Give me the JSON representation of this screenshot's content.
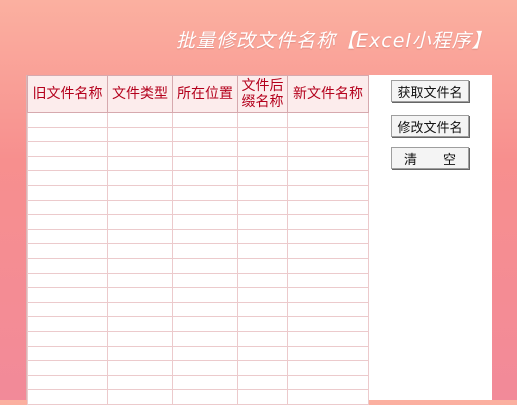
{
  "banner": {
    "title": "批量修改文件名称【Excel小程序】"
  },
  "table": {
    "headers": [
      "旧文件名称",
      "文件类型",
      "所在位置",
      "文件后缀名称",
      "新文件名称"
    ],
    "header_lines": [
      [
        "旧文件名称"
      ],
      [
        "文件类型"
      ],
      [
        "所在位置"
      ],
      [
        "文件后",
        "缀名称"
      ],
      [
        "新文件名称"
      ]
    ]
  },
  "buttons": {
    "get_name": "获取文件名",
    "rename": "修改文件名",
    "clear": "清　　空"
  },
  "colors": {
    "header_text": "#b4001c",
    "grid_line": "#eccacc",
    "background_top": "#fbb0a0",
    "background_bottom": "#f28a99"
  }
}
